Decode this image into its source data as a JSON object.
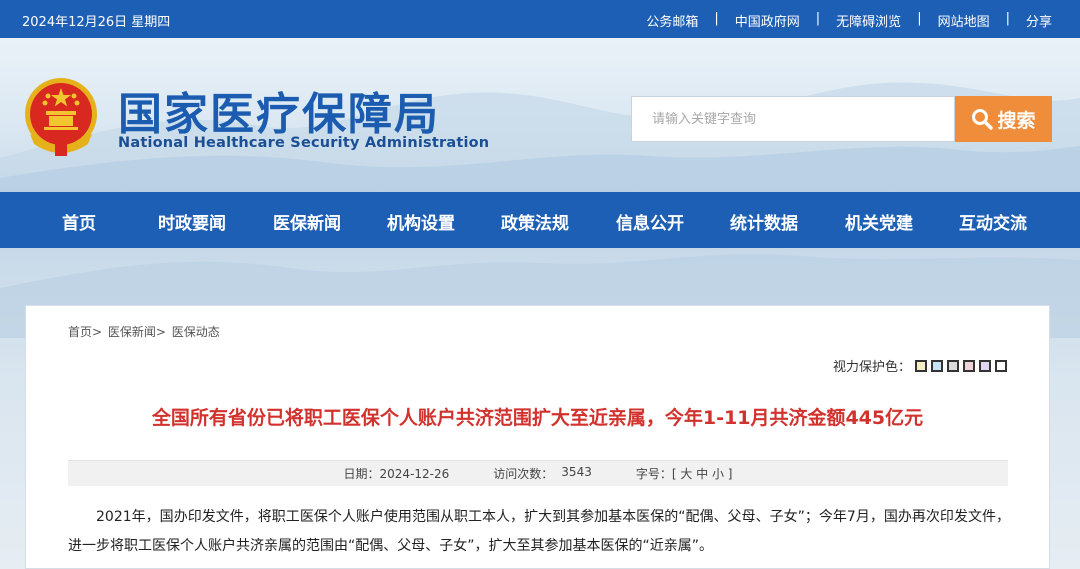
{
  "topbar": {
    "date": "2024年12月26日 星期四",
    "links": [
      "公务邮箱",
      "中国政府网",
      "无障碍浏览",
      "网站地图",
      "分享"
    ],
    "separator": "|"
  },
  "header": {
    "title": "国家医疗保障局",
    "subtitle": "National Healthcare Security Administration",
    "emblem_icon": "national-emblem-icon"
  },
  "search": {
    "placeholder": "请输入关键字查询",
    "button_label": "搜索",
    "button_icon": "search-icon"
  },
  "nav": {
    "items": [
      "首页",
      "时政要闻",
      "医保新闻",
      "机构设置",
      "政策法规",
      "信息公开",
      "统计数据",
      "机关党建",
      "互动交流"
    ]
  },
  "breadcrumb": [
    "首页>",
    "医保新闻>",
    "医保动态"
  ],
  "eyecare": {
    "label": "视力保护色：",
    "swatches": [
      "#f7eec8",
      "#c5e3f3",
      "#dcdcdc",
      "#f0d2d9",
      "#e1d7f1",
      "#ffffff"
    ]
  },
  "article": {
    "title": "全国所有省份已将职工医保个人账户共济范围扩大至近亲属，今年1-11月共济金额445亿元",
    "date_label": "日期：2024-12-26",
    "visits_label": "访问次数：",
    "visits_value": "3543",
    "fontsize_label": "字号：[ 大 中 小 ]",
    "paragraph": "2021年，国办印发文件，将职工医保个人账户使用范围从职工本人，扩大到其参加基本医保的“配偶、父母、子女”；今年7月，国办再次印发文件，进一步将职工医保个人账户共济亲属的范围由“配偶、父母、子女”，扩大至其参加基本医保的“近亲属”。"
  },
  "colors": {
    "brand_blue": "#1d5fb4",
    "search_orange": "#ef8d3a",
    "title_red": "#d2322d"
  }
}
